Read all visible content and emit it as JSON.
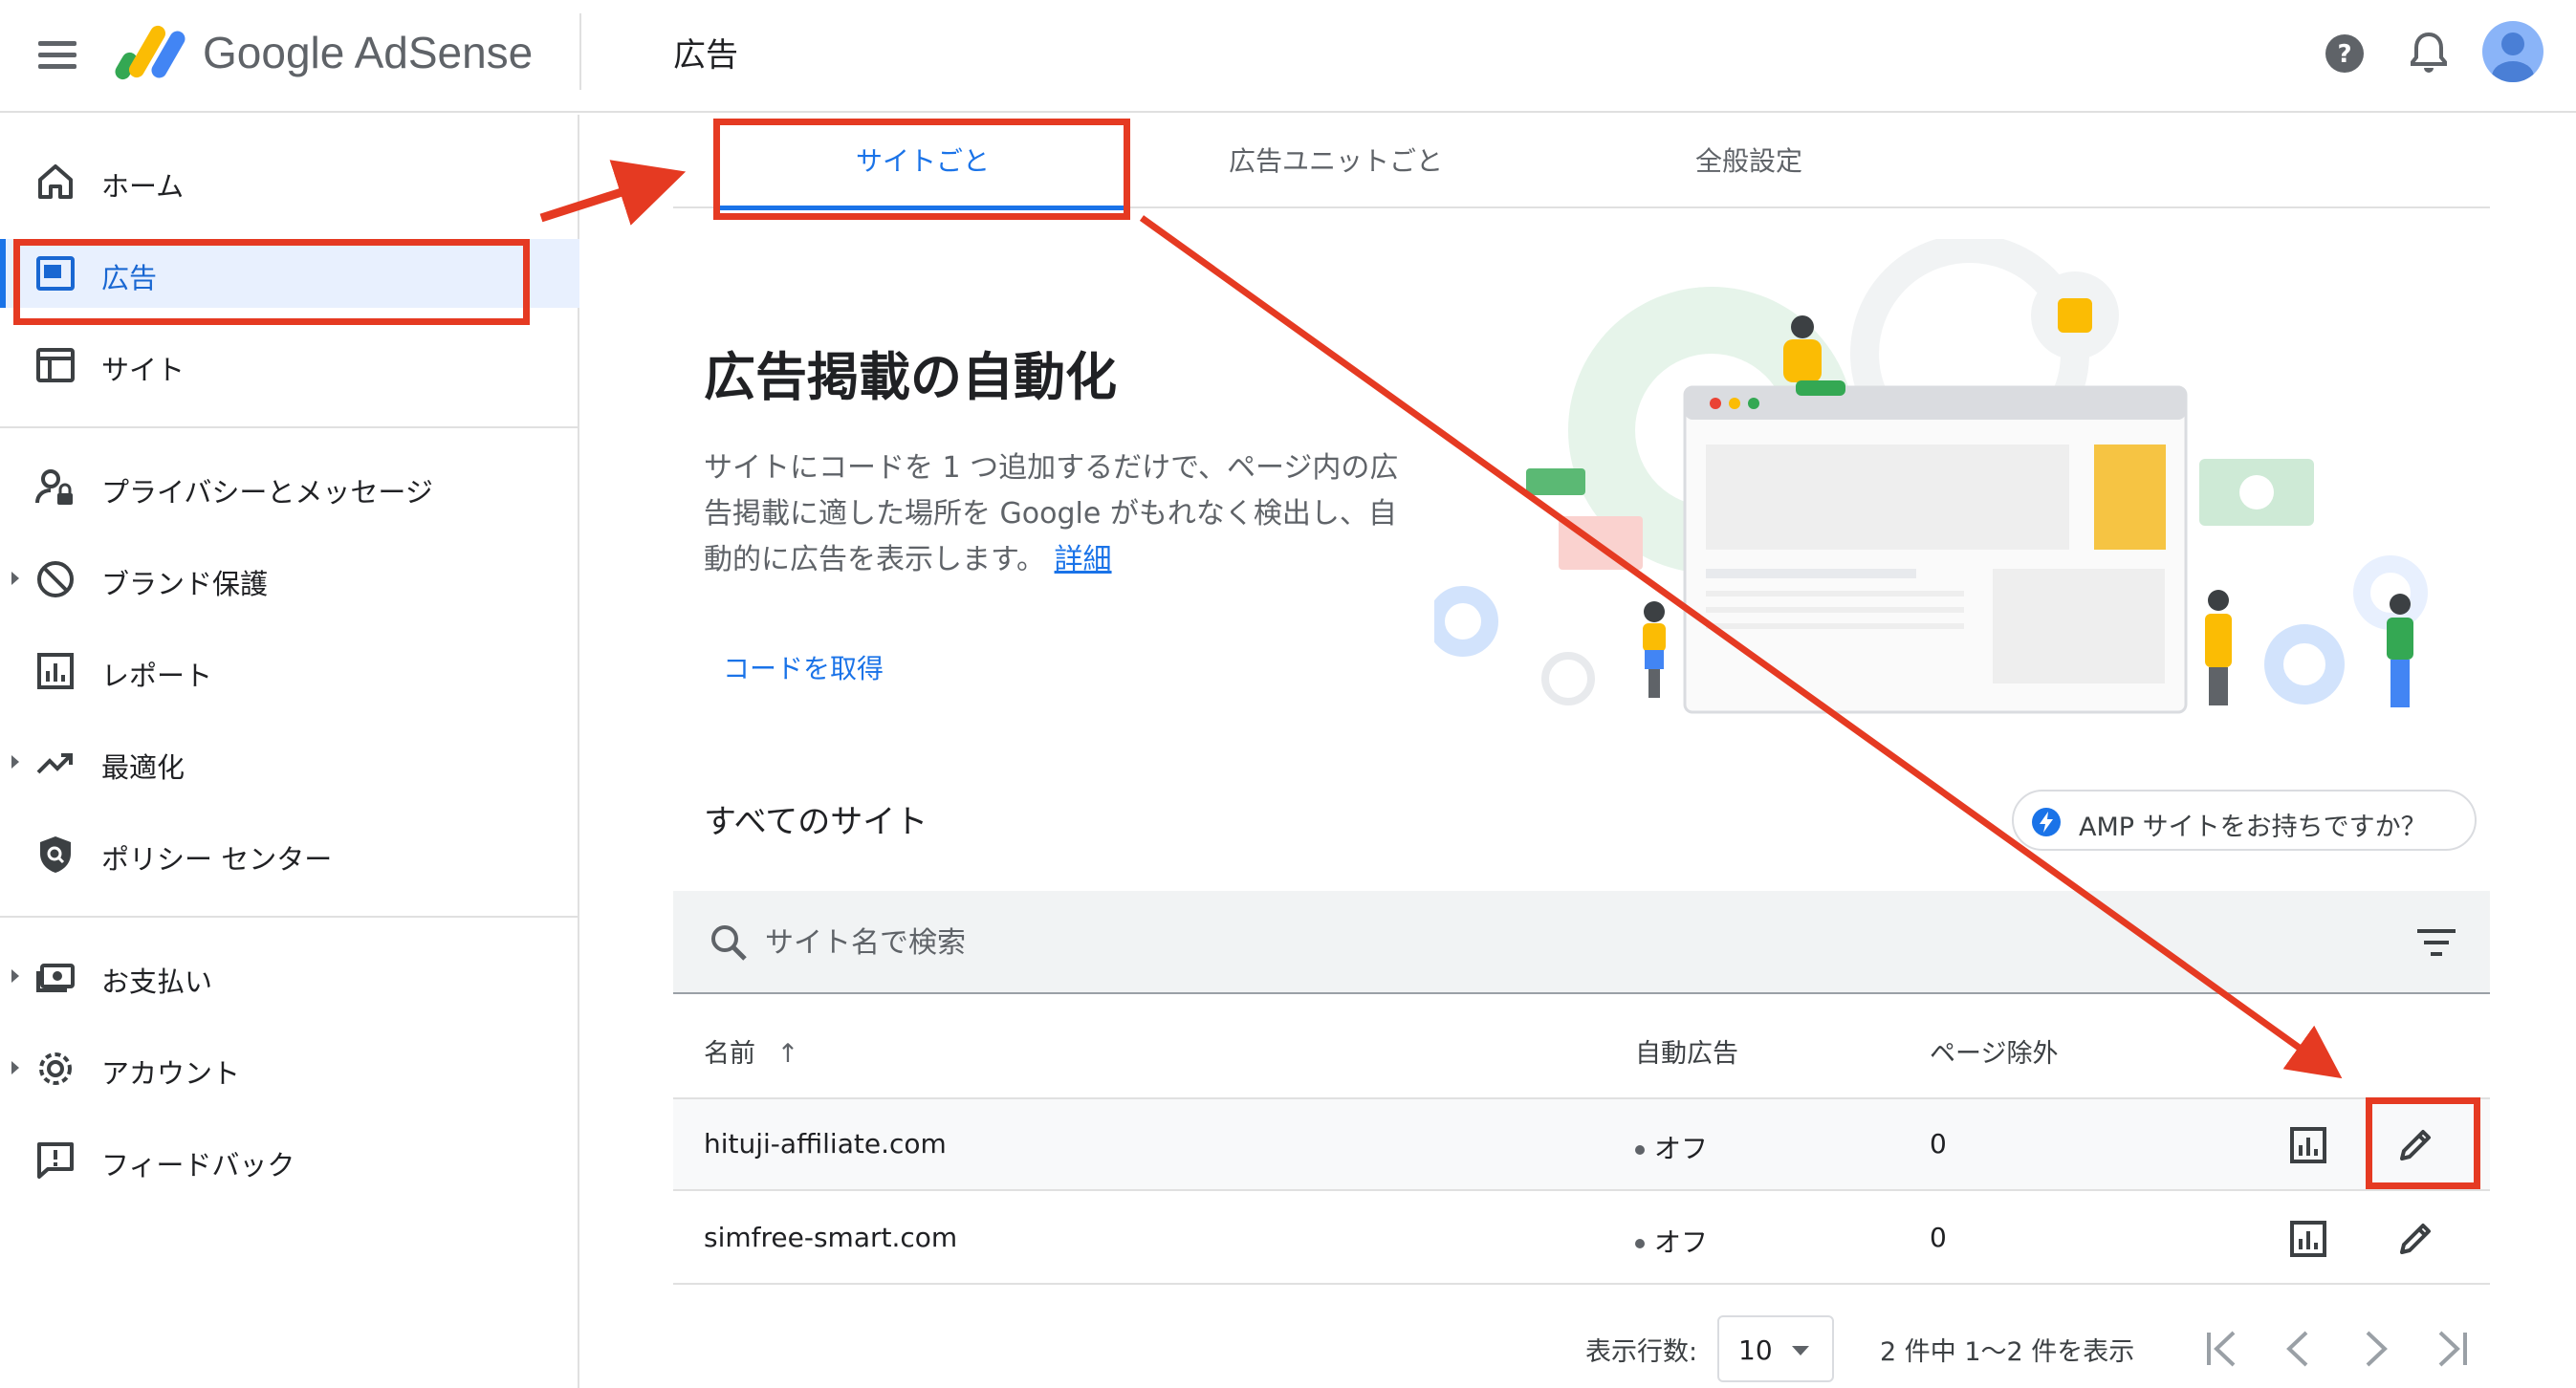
{
  "header": {
    "brand": "Google AdSense",
    "page_title": "広告"
  },
  "sidebar": {
    "items": [
      {
        "label": "ホーム",
        "icon": "home-icon"
      },
      {
        "label": "広告",
        "icon": "ads-icon",
        "active": true
      },
      {
        "label": "サイト",
        "icon": "sites-icon"
      },
      {
        "label": "プライバシーとメッセージ",
        "icon": "privacy-icon"
      },
      {
        "label": "ブランド保護",
        "icon": "block-icon",
        "expandable": true
      },
      {
        "label": "レポート",
        "icon": "report-icon"
      },
      {
        "label": "最適化",
        "icon": "trending-icon",
        "expandable": true
      },
      {
        "label": "ポリシー センター",
        "icon": "policy-shield-icon"
      },
      {
        "label": "お支払い",
        "icon": "payments-icon",
        "expandable": true
      },
      {
        "label": "アカウント",
        "icon": "gear-icon",
        "expandable": true
      },
      {
        "label": "フィードバック",
        "icon": "feedback-icon"
      }
    ]
  },
  "tabs": [
    {
      "label": "サイトごと",
      "active": true
    },
    {
      "label": "広告ユニットごと"
    },
    {
      "label": "全般設定"
    }
  ],
  "hero": {
    "title": "広告掲載の自動化",
    "description": "サイトにコードを 1 つ追加するだけで、ページ内の広告掲載に適した場所を Google がもれなく検出し、自動的に広告を表示します。",
    "details_link": "詳細",
    "get_code": "コードを取得"
  },
  "sites": {
    "title": "すべてのサイト",
    "amp_button": "AMP サイトをお持ちですか？",
    "search_placeholder": "サイト名で検索",
    "columns": {
      "name": "名前",
      "auto_ads": "自動広告",
      "page_exclusions": "ページ除外"
    },
    "rows": [
      {
        "name": "hituji-affiliate.com",
        "auto_ads": "オフ",
        "page_exclusions": "0"
      },
      {
        "name": "simfree-smart.com",
        "auto_ads": "オフ",
        "page_exclusions": "0"
      }
    ]
  },
  "pagination": {
    "rows_label": "表示行数:",
    "rows_value": "10",
    "range": "2 件中 1〜2 件を表示"
  },
  "colors": {
    "accent": "#1a73e8",
    "annotation": "#e53a22"
  }
}
